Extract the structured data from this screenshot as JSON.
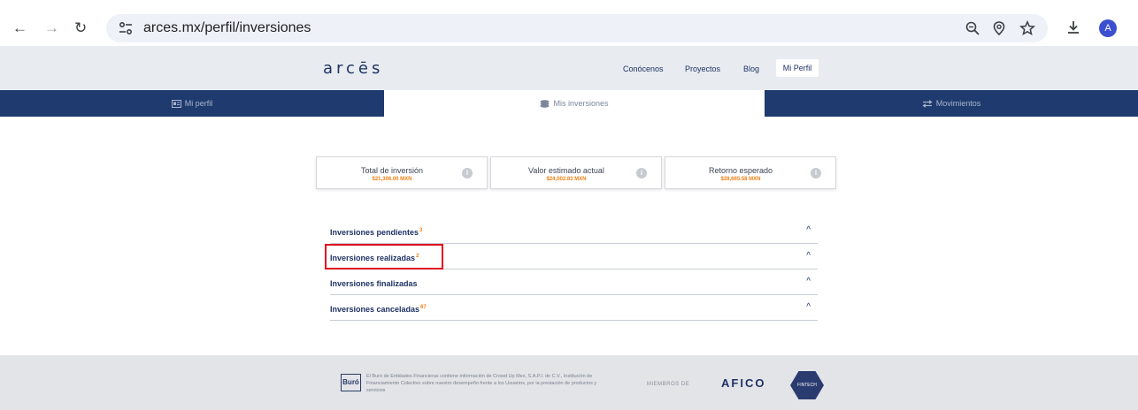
{
  "browser": {
    "url": "arces.mx/perfil/inversiones",
    "avatar_letter": "A"
  },
  "site": {
    "logo": "arcēs",
    "nav": [
      "Conócenos",
      "Proyectos",
      "Blog",
      "Mi Perfil"
    ]
  },
  "tabs": [
    {
      "label": "Mi perfil",
      "icon": "id-card-icon"
    },
    {
      "label": "Mis inversiones",
      "icon": "coins-stack-icon"
    },
    {
      "label": "Movimientos",
      "icon": "transfer-arrows-icon"
    }
  ],
  "summary_cards": [
    {
      "title": "Total de inversión",
      "value": "$21,306.00 MXN"
    },
    {
      "title": "Valor estimado actual",
      "value": "$24,002.83 MXN"
    },
    {
      "title": "Retorno esperado",
      "value": "$28,665.58 MXN"
    }
  ],
  "accordion": [
    {
      "label": "Inversiones pendientes",
      "count": "3"
    },
    {
      "label": "Inversiones realizadas",
      "count": "2"
    },
    {
      "label": "Inversiones finalizadas",
      "count": ""
    },
    {
      "label": "Inversiones canceladas",
      "count": "67"
    }
  ],
  "footer": {
    "buro_logo": "Buró",
    "buro_text": "El Buró de Entidades Financieras contiene información de Crowd Up Mex, S.A.P.I. de C.V., Institución de Financiamiento Colectivo sobre nuestro desempeño frente a los Usuarios, por la prestación de productos y servicios",
    "miembros": "MIEMBROS DE",
    "afico": "AFICO",
    "fintech": "FINTECH"
  },
  "colors": {
    "navy": "#1f3a6e",
    "accent_orange": "#f07f14",
    "highlight_red": "#e0101e"
  }
}
